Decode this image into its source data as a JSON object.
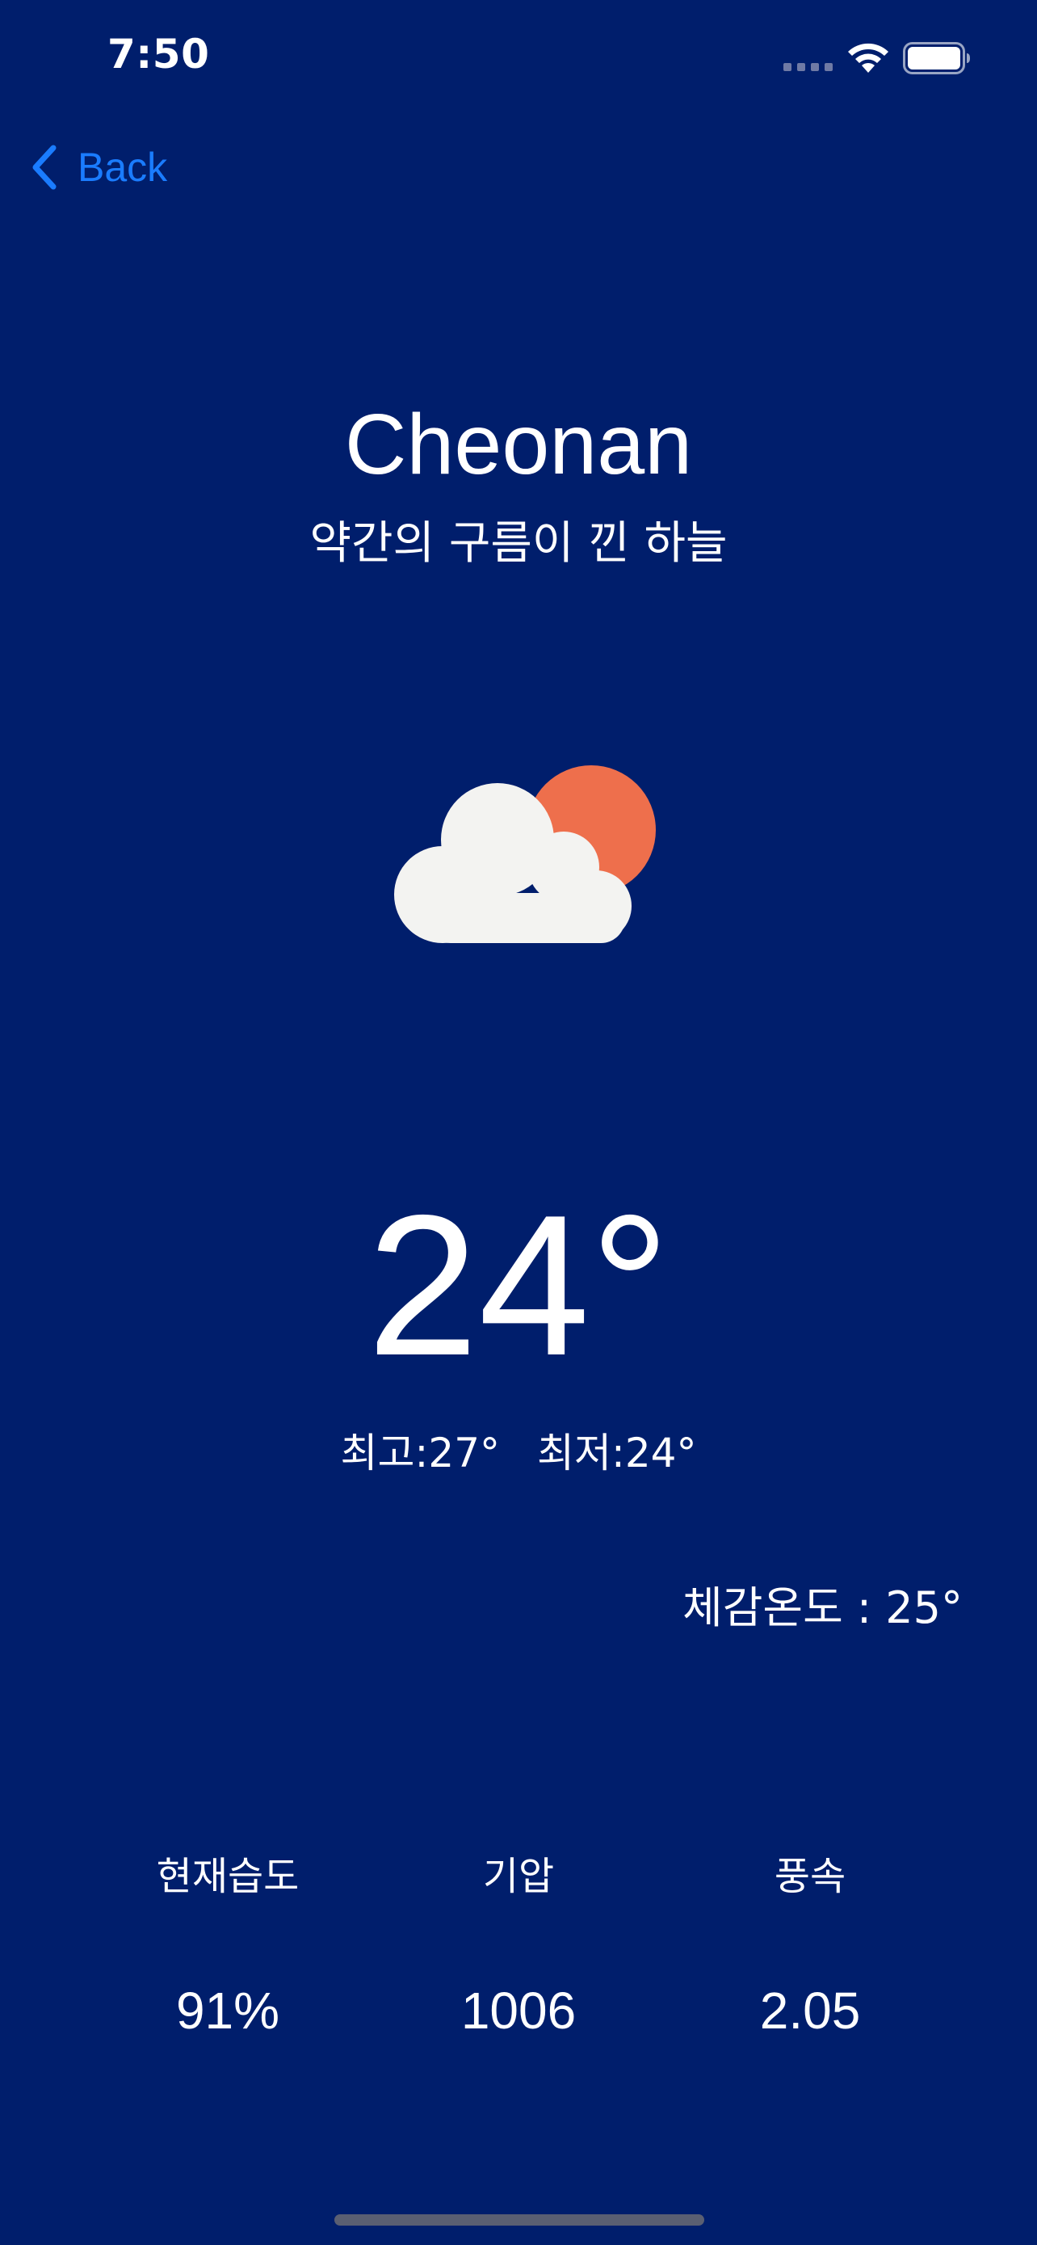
{
  "status_bar": {
    "time": "7:50"
  },
  "nav": {
    "back_label": "Back"
  },
  "weather": {
    "city": "Cheonan",
    "description": "약간의 구름이 낀 하늘",
    "icon": "partly-cloudy-sun-icon",
    "temperature": "24°",
    "high": "최고:27°",
    "low": "최저:24°",
    "feels_like": "체감온도 : 25°"
  },
  "stats": [
    {
      "label": "현재습도",
      "value": "91%"
    },
    {
      "label": "기압",
      "value": "1006"
    },
    {
      "label": "풍속",
      "value": "2.05"
    }
  ],
  "colors": {
    "background": "#001e6c",
    "accent": "#1a7cff",
    "sun": "#ee6f4c",
    "cloud": "#f3f3f1"
  }
}
